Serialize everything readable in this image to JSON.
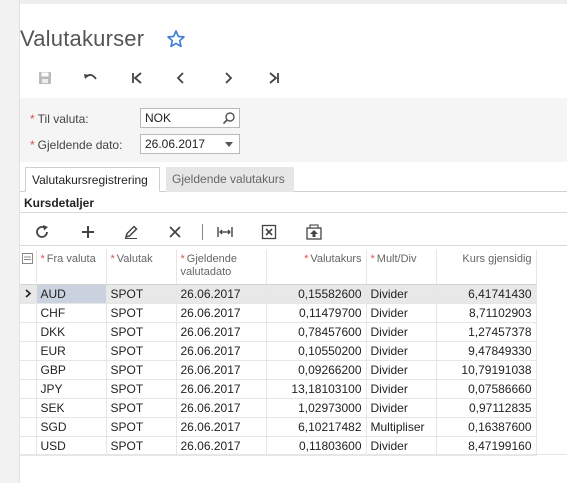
{
  "page": {
    "title": "Valutakurser"
  },
  "filters": {
    "currency_label": "Til valuta:",
    "currency_value": "NOK",
    "date_label": "Gjeldende dato:",
    "date_value": "26.06.2017"
  },
  "tabs": [
    {
      "label": "Valutakursregistrering",
      "active": true
    },
    {
      "label": "Gjeldende valutakurs",
      "active": false
    }
  ],
  "section": {
    "title": "Kursdetaljer"
  },
  "table": {
    "headers": {
      "from": "Fra valuta",
      "type": "Valutak",
      "date": "Gjeldende valutadato",
      "rate": "Valutakurs",
      "mult": "Mult/Div",
      "recip": "Kurs gjensidig"
    },
    "rows": [
      {
        "from": "AUD",
        "type": "SPOT",
        "date": "26.06.2017",
        "rate": "0,15582600",
        "mult": "Divider",
        "recip": "6,41741430"
      },
      {
        "from": "CHF",
        "type": "SPOT",
        "date": "26.06.2017",
        "rate": "0,11479700",
        "mult": "Divider",
        "recip": "8,71102903"
      },
      {
        "from": "DKK",
        "type": "SPOT",
        "date": "26.06.2017",
        "rate": "0,78457600",
        "mult": "Divider",
        "recip": "1,27457378"
      },
      {
        "from": "EUR",
        "type": "SPOT",
        "date": "26.06.2017",
        "rate": "0,10550200",
        "mult": "Divider",
        "recip": "9,47849330"
      },
      {
        "from": "GBP",
        "type": "SPOT",
        "date": "26.06.2017",
        "rate": "0,09266200",
        "mult": "Divider",
        "recip": "10,79191038"
      },
      {
        "from": "JPY",
        "type": "SPOT",
        "date": "26.06.2017",
        "rate": "13,18103100",
        "mult": "Divider",
        "recip": "0,07586660"
      },
      {
        "from": "SEK",
        "type": "SPOT",
        "date": "26.06.2017",
        "rate": "1,02973000",
        "mult": "Divider",
        "recip": "0,97112835"
      },
      {
        "from": "SGD",
        "type": "SPOT",
        "date": "26.06.2017",
        "rate": "6,10217482",
        "mult": "Multipliser",
        "recip": "0,16387600"
      },
      {
        "from": "USD",
        "type": "SPOT",
        "date": "26.06.2017",
        "rate": "0,11803600",
        "mult": "Divider",
        "recip": "8,47199160"
      }
    ]
  },
  "colors": {
    "star": "#3a7bd5",
    "required": "#d9534f",
    "selected_row": "#e8e8e8",
    "selected_cell": "#c9d2de"
  },
  "icons": [
    "star-icon",
    "save-icon",
    "undo-icon",
    "first-icon",
    "previous-icon",
    "next-icon",
    "last-icon",
    "search-icon",
    "dropdown-icon",
    "refresh-icon",
    "add-icon",
    "edit-icon",
    "delete-icon",
    "fit-columns-icon",
    "export-excel-icon",
    "upload-icon",
    "row-selector-icon"
  ]
}
